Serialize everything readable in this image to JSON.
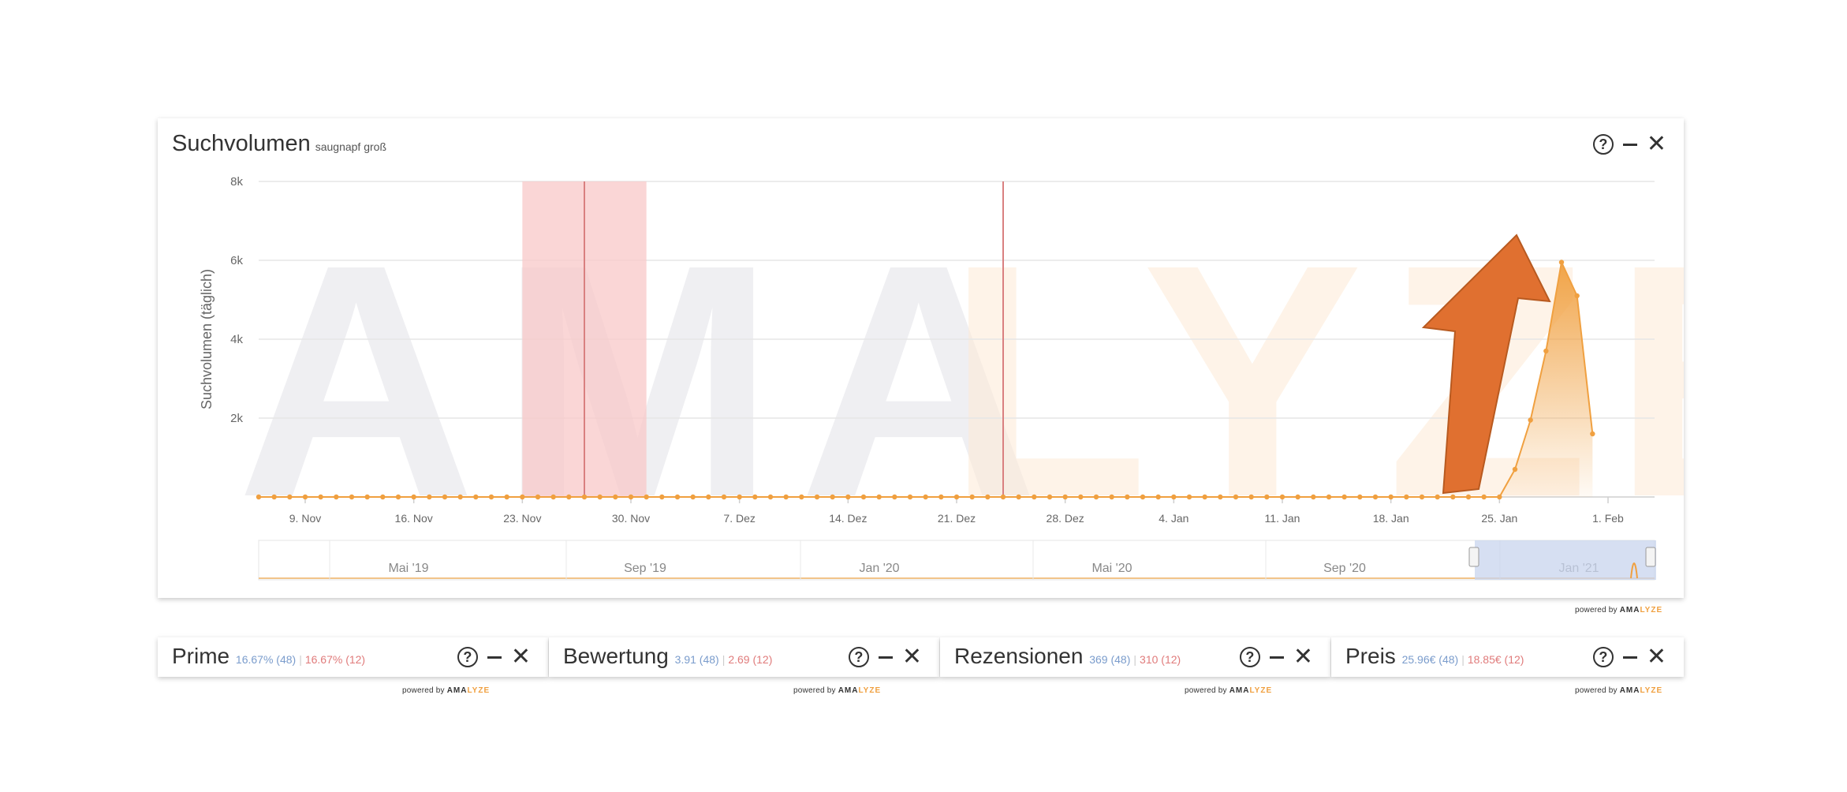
{
  "main_card": {
    "title": "Suchvolumen",
    "subtitle": "saugnapf groß",
    "watermark": {
      "ama": "AMA",
      "lyze": "LYZE"
    }
  },
  "controls": {
    "help": "?",
    "close": "✕"
  },
  "powered": {
    "prefix": "powered by ",
    "ama": "AMA",
    "lyze": "LYZE"
  },
  "navigator": {
    "labels": [
      "Mai '19",
      "Sep '19",
      "Jan '20",
      "Mai '20",
      "Sep '20",
      "Jan '21"
    ]
  },
  "small_cards": [
    {
      "title": "Prime",
      "v1": "16.67% (48)",
      "v2": "16.67% (12)"
    },
    {
      "title": "Bewertung",
      "v1": "3.91 (48)",
      "v2": "2.69 (12)"
    },
    {
      "title": "Rezensionen",
      "v1": "369 (48)",
      "v2": "310 (12)"
    },
    {
      "title": "Preis",
      "v1": "25.96€ (48)",
      "v2": "18.85€ (12)"
    }
  ],
  "colors": {
    "series": "#f0a040",
    "marker": "#e88a8a",
    "band": "#f8c8c8",
    "arrow": "#e07030",
    "navigator_sel": "#c8d4ee"
  },
  "chart_data": {
    "type": "line",
    "ylabel": "Suchvolumen (täglich)",
    "yticks": [
      "2k",
      "4k",
      "6k",
      "8k"
    ],
    "ylim": [
      0,
      8000
    ],
    "xticks": [
      "9. Nov",
      "16. Nov",
      "23. Nov",
      "30. Nov",
      "7. Dez",
      "14. Dez",
      "21. Dez",
      "28. Dez",
      "4. Jan",
      "11. Jan",
      "18. Jan",
      "25. Jan",
      "1. Feb"
    ],
    "xrange": [
      "2020-11-06",
      "2021-02-04"
    ],
    "series": [
      {
        "start": "2020-11-06",
        "zero_until": "2021-01-24",
        "points": [
          [
            "2021-01-25",
            0
          ],
          [
            "2021-01-26",
            700
          ],
          [
            "2021-01-27",
            1950
          ],
          [
            "2021-01-28",
            3700
          ],
          [
            "2021-01-29",
            5950
          ],
          [
            "2021-01-30",
            5100
          ],
          [
            "2021-01-31",
            1600
          ]
        ]
      }
    ],
    "band": [
      "2020-11-23",
      "2020-12-01"
    ],
    "markers": [
      "2020-11-27",
      "2020-12-24"
    ],
    "grid": true
  }
}
